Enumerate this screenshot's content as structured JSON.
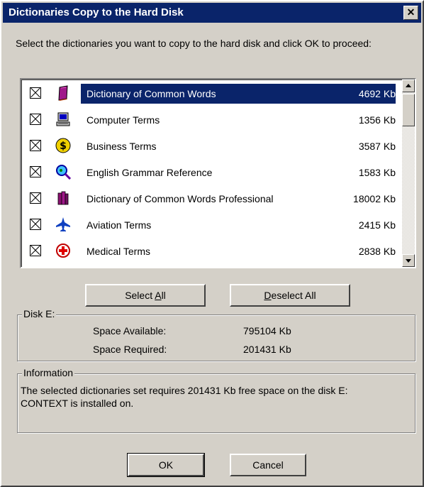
{
  "window": {
    "title": "Dictionaries Copy to the Hard Disk",
    "close_glyph": "✕"
  },
  "instruction": "Select the dictionaries you want to copy to the hard disk and click OK to proceed:",
  "dictionaries": [
    {
      "name": "Dictionary of Common Words",
      "size": "4692 Kb",
      "icon": "book-icon",
      "selected": true
    },
    {
      "name": "Computer Terms",
      "size": "1356 Kb",
      "icon": "computer-icon"
    },
    {
      "name": "Business Terms",
      "size": "3587 Kb",
      "icon": "dollar-coin-icon"
    },
    {
      "name": "English Grammar Reference",
      "size": "1583 Kb",
      "icon": "magnifier-icon"
    },
    {
      "name": "Dictionary of Common Words Professional",
      "size": "18002 Kb",
      "icon": "books-icon"
    },
    {
      "name": "Aviation Terms",
      "size": "2415 Kb",
      "icon": "airplane-icon"
    },
    {
      "name": "Medical Terms",
      "size": "2838 Kb",
      "icon": "medical-cross-icon"
    }
  ],
  "buttons": {
    "select_all_pre": "Select ",
    "select_all_u": "A",
    "select_all_post": "ll",
    "deselect_all_u": "D",
    "deselect_all_post": "eselect All",
    "ok": "OK",
    "cancel": "Cancel"
  },
  "disk": {
    "group_title": "Disk E:",
    "available_label": "Space Available:",
    "available_value": "795104 Kb",
    "required_label": "Space Required:",
    "required_value": "201431 Kb"
  },
  "information": {
    "group_title": "Information",
    "text_line1": "The selected dictionaries set requires 201431 Kb free space on the disk E:",
    "text_line2": "CONTEXT is installed on."
  }
}
